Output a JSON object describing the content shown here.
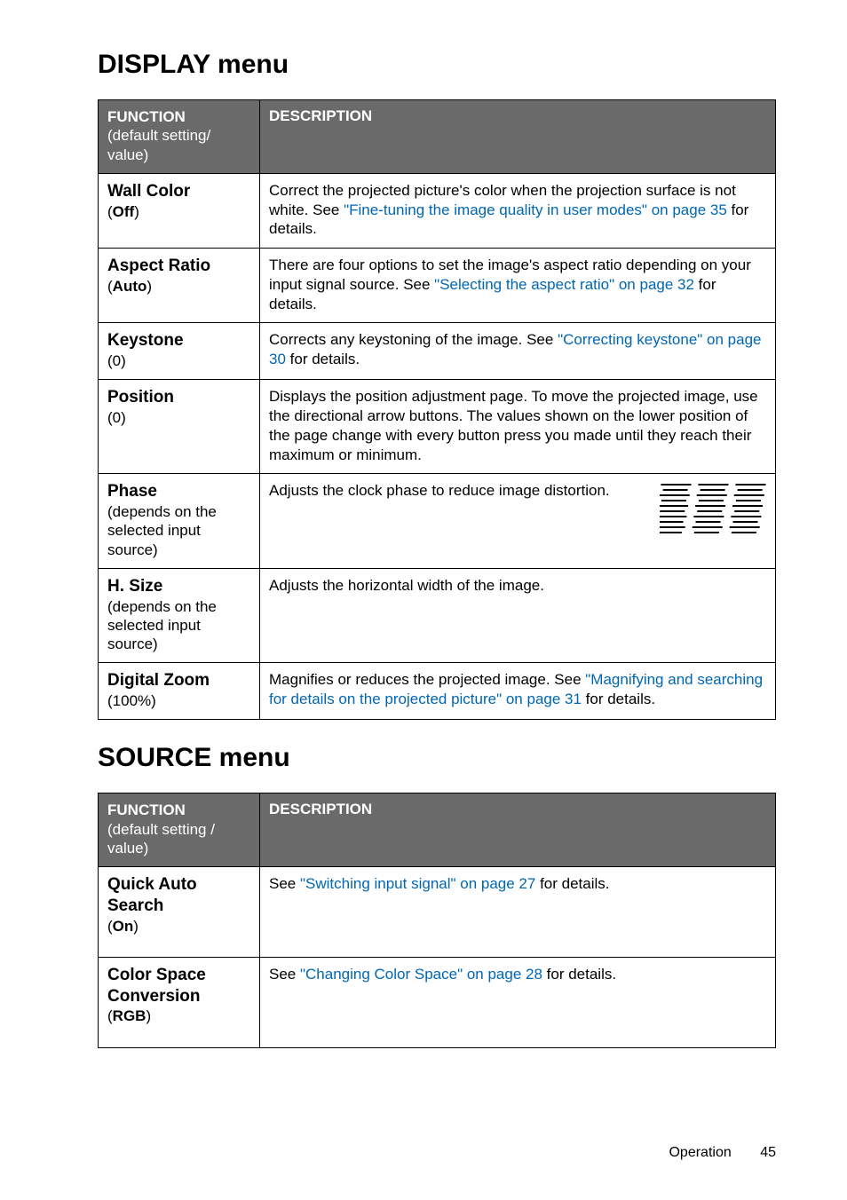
{
  "section1_title": "DISPLAY menu",
  "section2_title": "SOURCE menu",
  "header": {
    "func_label": "FUNCTION",
    "func_sub": "(default setting/ value)",
    "func_sub2": "(default setting / value)",
    "desc_label": "DESCRIPTION"
  },
  "display_rows": {
    "wall_color": {
      "name": "Wall Color",
      "sub": "(Off)",
      "desc_pre": "Correct the projected picture's color when the projection surface is not white. See ",
      "link": "\"Fine-tuning the image quality in user modes\" on page 35",
      "desc_post": " for details."
    },
    "aspect_ratio": {
      "name": "Aspect Ratio",
      "sub": "(Auto)",
      "desc_pre": "There are four options to set the image's aspect ratio depending on your input signal source. See ",
      "link": "\"Selecting the aspect ratio\" on page 32",
      "desc_post": " for details."
    },
    "keystone": {
      "name": "Keystone",
      "sub": "(0)",
      "desc_pre": "Corrects any keystoning of the image. See ",
      "link": "\"Correcting keystone\" on page 30",
      "desc_post": " for details."
    },
    "position": {
      "name": "Position",
      "sub": "(0)",
      "desc": "Displays the position adjustment page. To move the projected image, use the directional arrow buttons. The values shown on the lower position of the page change with every button press you made until they reach their maximum or minimum."
    },
    "phase": {
      "name": "Phase",
      "sub": "(depends on the selected input source)",
      "desc": "Adjusts the clock phase to reduce image distortion."
    },
    "hsize": {
      "name": "H. Size",
      "sub": "(depends on the selected input source)",
      "desc": "Adjusts the horizontal width of the image."
    },
    "digital_zoom": {
      "name": "Digital Zoom",
      "sub": "(100%)",
      "desc_pre": "Magnifies or reduces the projected image. See ",
      "link": "\"Magnifying and searching for details on the projected picture\" on page 31",
      "desc_post": " for details."
    }
  },
  "source_rows": {
    "quick_auto": {
      "name": "Quick Auto Search",
      "sub": "(On)",
      "desc_pre": "See ",
      "link": "\"Switching input signal\" on page 27",
      "desc_post": " for details."
    },
    "color_space": {
      "name": "Color Space Conversion",
      "sub": "(RGB)",
      "desc_pre": "See ",
      "link": "\"Changing Color Space\" on page 28",
      "desc_post": " for details."
    }
  },
  "footer": {
    "label": "Operation",
    "page": "45"
  }
}
